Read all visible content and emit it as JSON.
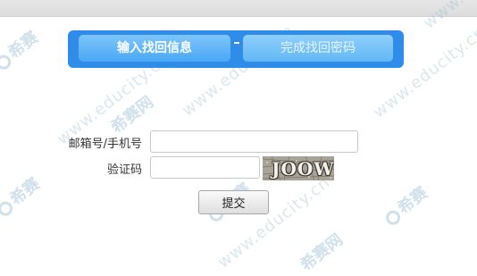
{
  "steps": [
    {
      "label": "输入找回信息",
      "active": true
    },
    {
      "label": "完成找回密码",
      "active": false
    }
  ],
  "form": {
    "email_label": "邮箱号/手机号",
    "email_value": "",
    "captcha_label": "验证码",
    "captcha_value": "",
    "captcha_image_text": "JOOW",
    "submit_label": "提交"
  },
  "watermark": {
    "brand": "希赛",
    "url": "www.educity.cn",
    "site": "希赛网"
  },
  "colors": {
    "tab_container": "#2f8ce8",
    "active_tab": "#49a8f4",
    "inactive_tab": "#62b7f6",
    "captcha_bg": "#a7a198"
  }
}
